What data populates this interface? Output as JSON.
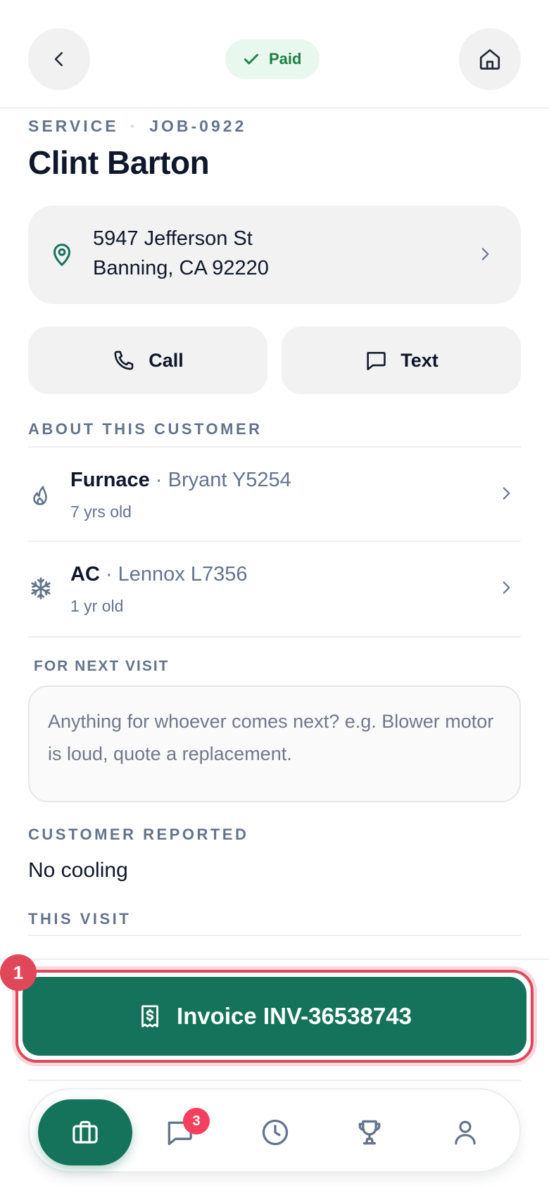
{
  "header": {
    "status_label": "Paid"
  },
  "job": {
    "type": "SERVICE",
    "separator": "·",
    "id": "JOB-0922",
    "customer_name": "Clint Barton"
  },
  "address": {
    "line1": "5947 Jefferson St",
    "line2": "Banning, CA 92220"
  },
  "actions": {
    "call_label": "Call",
    "text_label": "Text"
  },
  "about": {
    "section_label": "ABOUT THIS CUSTOMER",
    "equipment": [
      {
        "name": "Furnace",
        "separator": " · ",
        "model": "Bryant Y5254",
        "age": "7 yrs old",
        "icon": "flame-icon"
      },
      {
        "name": "AC",
        "separator": " · ",
        "model": "Lennox L7356",
        "age": "1 yr old",
        "icon": "snowflake-icon"
      }
    ]
  },
  "next_visit": {
    "section_label": "FOR NEXT VISIT",
    "placeholder": "Anything for whoever comes next? e.g. Blower motor is loud, quote a replacement.",
    "value": ""
  },
  "customer_reported": {
    "section_label": "CUSTOMER REPORTED",
    "value": "No cooling"
  },
  "this_visit": {
    "section_label": "THIS VISIT"
  },
  "invoice": {
    "label": "Invoice INV-36538743",
    "step_number": "1"
  },
  "bottom_nav": {
    "items": [
      {
        "icon": "briefcase-icon",
        "active": true
      },
      {
        "icon": "chat-icon",
        "badge": "3"
      },
      {
        "icon": "clock-icon"
      },
      {
        "icon": "trophy-icon"
      },
      {
        "icon": "person-icon"
      }
    ]
  },
  "colors": {
    "brand": "#14735a",
    "paid_text": "#1a7f45",
    "paid_bg": "#e8f8ee",
    "highlight": "#e0485a",
    "badge": "#f43f5e",
    "muted": "#64748b"
  }
}
